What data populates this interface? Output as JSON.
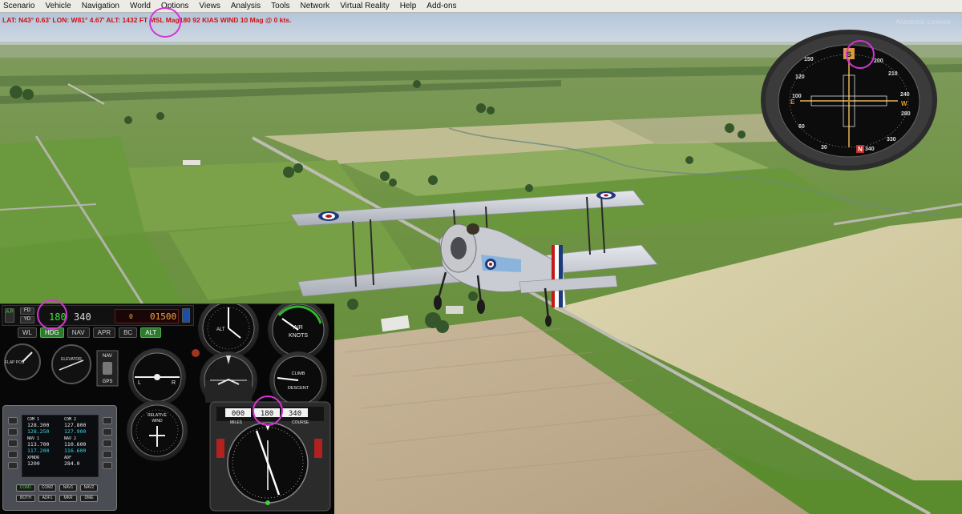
{
  "menubar": {
    "items": [
      "Scenario",
      "Vehicle",
      "Navigation",
      "World",
      "Options",
      "Views",
      "Analysis",
      "Tools",
      "Network",
      "Virtual Reality",
      "Help",
      "Add-ons"
    ]
  },
  "status": {
    "line": "LAT: N43° 0.63'  LON: W81° 4.67'  ALT: 1432 FT  MSL  Mag180  92 KIAS  WIND 10 Mag @ 0 kts.",
    "license": "Academic License"
  },
  "autopilot": {
    "ap_label": "A\nP",
    "fd_label": "FD",
    "yd_label": "YD",
    "heading": "180",
    "altitude": "340",
    "vs_small": "0",
    "vs": "01500",
    "modes": [
      "WL",
      "HDG",
      "NAV",
      "APR",
      "BC",
      "ALT"
    ],
    "active_modes": [
      "HDG",
      "ALT"
    ]
  },
  "instruments": {
    "flaps_label": "FLAP\nPOS",
    "elevator_label": "ELEVATOR",
    "nav_label": "NAV",
    "gps_label": "GPS",
    "alt_label": "ALT",
    "airspeed_label": "AIR",
    "knots_label": "KNOTS",
    "turn_l": "L",
    "turn_r": "R",
    "climb_label": "CLIMB",
    "descent_label": "DESCENT",
    "relative_label": "RELATIVE",
    "wind_label": "WIND",
    "miles_label": "MILES",
    "course_label": "COURSE",
    "dme_miles": "000",
    "hsi_heading": "180",
    "hsi_course": "340"
  },
  "radio": {
    "com1_label": "COM 1",
    "com1_active": "128.300",
    "com1_standby": "128.250",
    "com2_label": "COM 2",
    "com2_active": "127.800",
    "com2_standby": "127.900",
    "nav1_label": "NAV 1",
    "nav1_active": "113.700",
    "nav1_standby": "117.200",
    "nav2_label": "NAV 2",
    "nav2_active": "110.600",
    "nav2_standby": "116.600",
    "xpndr_label": "XPNDR",
    "xpndr": "1200",
    "adf_label": "ADF",
    "adf": "284.0",
    "buttons_row1": [
      "COM1",
      "COM2",
      "NAV1",
      "NAV2"
    ],
    "buttons_row2": [
      "BOTH",
      "ADF1",
      "MKR",
      "DME"
    ]
  },
  "compass": {
    "card_label": "S",
    "labels": [
      "E",
      "W",
      "N"
    ],
    "numbers": [
      "150",
      "200",
      "210",
      "240",
      "280",
      "330",
      "340",
      "30",
      "60",
      "100",
      "120"
    ]
  },
  "colors": {
    "highlight": "#d633d6",
    "status_red": "#d01010",
    "ap_green": "#3ce43c",
    "ap_amber": "#f2a63a",
    "radio_cyan": "#35d8e8"
  }
}
